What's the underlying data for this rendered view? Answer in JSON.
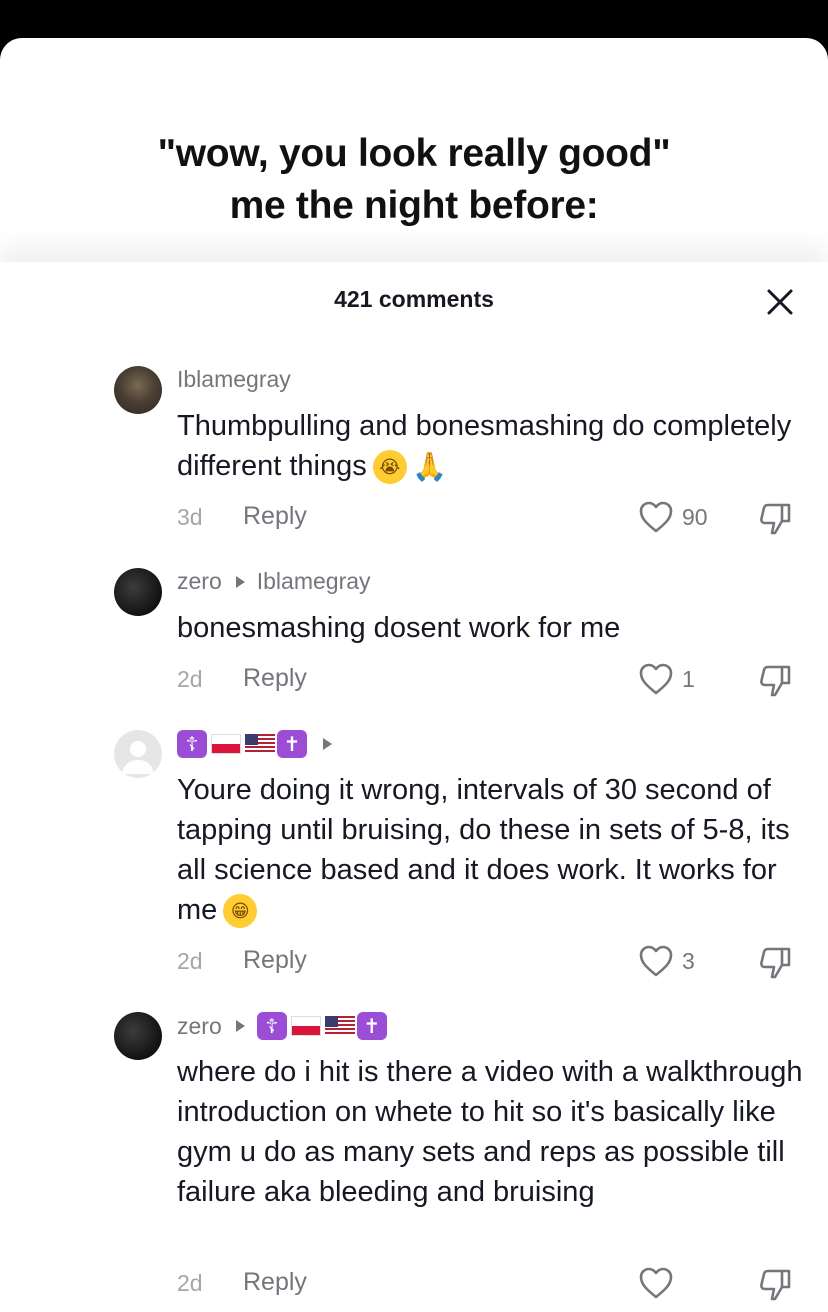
{
  "video": {
    "caption_line1": "\"wow, you look really good\"",
    "caption_line2": "me the night before:"
  },
  "sheet": {
    "title": "421 comments"
  },
  "comments": [
    {
      "author": "Iblamegray",
      "reply_to": "",
      "text": "Thumbpulling and bonesmashing do completely different things",
      "emojis": [
        "loudly-crying-face",
        "folded-hands"
      ],
      "time": "3d",
      "reply_label": "Reply",
      "likes": "90"
    },
    {
      "author": "zero",
      "reply_to": "Iblamegray",
      "text": "bonesmashing dosent work for me",
      "time": "2d",
      "reply_label": "Reply",
      "likes": "1"
    },
    {
      "author_emojis": [
        "orthodox-cross",
        "flag-poland",
        "flag-usa",
        "latin-cross"
      ],
      "text": "Youre doing it wrong, intervals of 30 second of tapping until bruising, do these in sets of 5-8, its all science based and it does work. It works for me",
      "emojis": [
        "grinning-face"
      ],
      "time": "2d",
      "reply_label": "Reply",
      "likes": "3"
    },
    {
      "author": "zero",
      "reply_to_emojis": [
        "orthodox-cross",
        "flag-poland",
        "flag-usa",
        "latin-cross"
      ],
      "text": "where do i hit is there a video with a walkthrough introduction on whete to hit so it's basically like gym u do as many sets and reps as possible till failure aka bleeding and bruising",
      "time": "2d",
      "reply_label": "Reply",
      "likes": ""
    }
  ],
  "icons": {
    "close": "close-icon",
    "like": "heart-outline-icon",
    "dislike": "thumbs-down-icon"
  },
  "colors": {
    "text_primary": "#161823",
    "text_secondary": "#75767c",
    "text_tertiary": "#a5a6ab",
    "cross_badge": "#9b4dd6"
  }
}
